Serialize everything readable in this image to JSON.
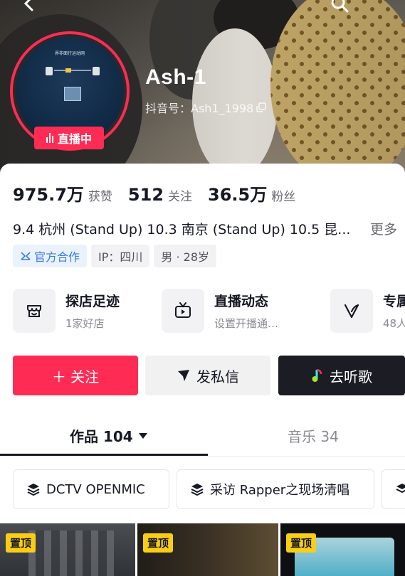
{
  "header": {
    "username": "Ash-1",
    "douyin_id_label": "抖音号：Ash1_1998",
    "live_badge": "直播中",
    "avatar_caption": "界非面行运动网"
  },
  "stats": [
    {
      "value": "975.7万",
      "label": "获赞"
    },
    {
      "value": "512",
      "label": "关注"
    },
    {
      "value": "36.5万",
      "label": "粉丝"
    }
  ],
  "bio": {
    "text": "9.4 杭州 (Stand Up) 10.3 南京 (Stand Up) 10.5 昆...",
    "more": "更多"
  },
  "tags": {
    "official": "官方合作",
    "ip": "IP：四川",
    "gender_age": "男 · 28岁"
  },
  "features": [
    {
      "title": "探店足迹",
      "subtitle": "1家好店",
      "icon": "shop-icon"
    },
    {
      "title": "直播动态",
      "subtitle": "设置开播通…",
      "icon": "tv-icon"
    },
    {
      "title": "专属",
      "subtitle": "48人",
      "icon": "v-icon"
    }
  ],
  "actions": {
    "follow": "＋ 关注",
    "message": "发私信",
    "music": "去听歌"
  },
  "tabs": {
    "works": "作品 104",
    "music": "音乐 34"
  },
  "collections": [
    {
      "label": "DCTV OPENMIC"
    },
    {
      "label": "采访 Rapper之现场清唱"
    }
  ],
  "pinned_label": "置顶",
  "colors": {
    "accent": "#fe2c55",
    "dark_button": "#1b1c24",
    "official_blue": "#3a7de0",
    "pin_yellow": "#face15"
  }
}
